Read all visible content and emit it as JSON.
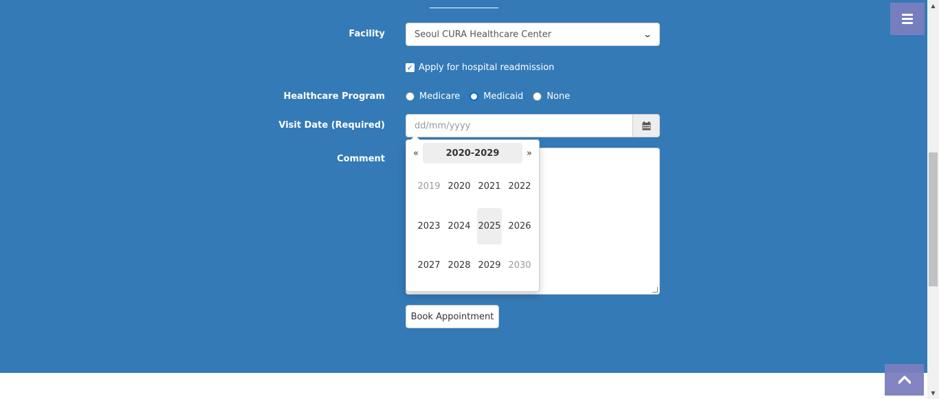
{
  "form": {
    "facility_label": "Facility",
    "facility_value": "Seoul CURA Healthcare Center",
    "readmission_label": "Apply for hospital readmission",
    "readmission_checked": true,
    "program_label": "Healthcare Program",
    "program_options": [
      "Medicare",
      "Medicaid",
      "None"
    ],
    "visit_date_label": "Visit Date (Required)",
    "visit_date_placeholder": "dd/mm/yyyy",
    "comment_label": "Comment",
    "book_button": "Book Appointment"
  },
  "datepicker": {
    "prev": "«",
    "next": "»",
    "decade": "2020-2029",
    "years": [
      "2019",
      "2020",
      "2021",
      "2022",
      "2023",
      "2024",
      "2025",
      "2026",
      "2027",
      "2028",
      "2029",
      "2030"
    ],
    "highlighted_year": "2025"
  },
  "icons": {
    "menu": "hamburger-menu-icon",
    "calendar": "calendar-icon",
    "scroll_top": "chevron-up-icon"
  },
  "colors": {
    "hero_bg": "#337ab7",
    "floating_button": "#7b7ebe"
  }
}
